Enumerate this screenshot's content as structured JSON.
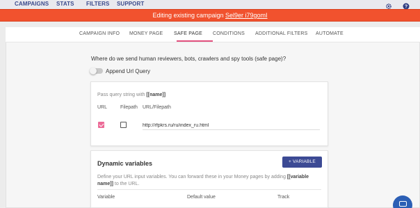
{
  "topnav": {
    "items": [
      "CAMPAIGNS",
      "STATS",
      "FILTERS",
      "SUPPORT"
    ]
  },
  "banner": {
    "text": "Editing existing campaign ",
    "campaign_link": "Sel9er i79gomI"
  },
  "tabs": [
    "CAMPAIGN INFO",
    "MONEY PAGE",
    "SAFE PAGE",
    "CONDITIONS",
    "ADDITIONAL FILTERS",
    "AUTOMATE"
  ],
  "active_tab": "SAFE PAGE",
  "safe_page": {
    "question": "Where do we send human reviewers, bots, crawlers and spy tools (safe page)?",
    "append_url_query_label": "Append Url Query",
    "append_url_query_on": false
  },
  "url_card": {
    "hint_prefix": "Pass query string with ",
    "hint_token": "[[name]]",
    "col_url": "URL",
    "col_filepath": "Filepath",
    "col_url_filepath": "URL/Filepath",
    "url_checked": true,
    "filepath_checked": false,
    "url_value": "http://rfpkrs.ru/ru/index_ru.html"
  },
  "dynamic_card": {
    "title": "Dynamic variables",
    "button_label": "+ VARIABLE",
    "desc_prefix": "Define your URL input variables. You can forward these in your Money pages by adding ",
    "desc_token": "[[variable name]]",
    "desc_suffix": " to the URL.",
    "headers": [
      "Variable",
      "Default value",
      "Track"
    ]
  },
  "colors": {
    "banner": "#f1522e",
    "nav_text": "#3b4a8c",
    "tab_accent": "#e2507e",
    "checkbox_checked": "#ec6b97",
    "button": "#3c4a94",
    "chat_fab": "#2c5fb5"
  },
  "icons": {
    "settings": "gear-icon",
    "help": "help-icon",
    "chat": "chat-icon"
  }
}
